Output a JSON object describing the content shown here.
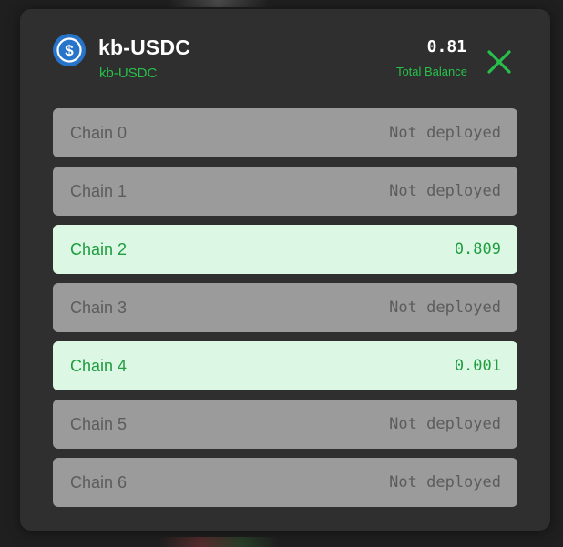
{
  "token": {
    "name": "kb-USDC",
    "subtitle": "kb-USDC",
    "icon": "usdc-dollar-icon"
  },
  "balance": {
    "value": "0.81",
    "label": "Total Balance"
  },
  "close": {
    "icon": "close-x-icon",
    "color": "#27c04a"
  },
  "colors": {
    "accent_green": "#27c04a",
    "deployed_bg": "#dcf8e5",
    "undeployed_bg": "#9b9b9b",
    "usdc_blue": "#2775ca"
  },
  "chains": [
    {
      "label": "Chain 0",
      "status": "Not deployed",
      "deployed": false
    },
    {
      "label": "Chain 1",
      "status": "Not deployed",
      "deployed": false
    },
    {
      "label": "Chain 2",
      "status": "0.809",
      "deployed": true
    },
    {
      "label": "Chain 3",
      "status": "Not deployed",
      "deployed": false
    },
    {
      "label": "Chain 4",
      "status": "0.001",
      "deployed": true
    },
    {
      "label": "Chain 5",
      "status": "Not deployed",
      "deployed": false
    },
    {
      "label": "Chain 6",
      "status": "Not deployed",
      "deployed": false
    }
  ]
}
